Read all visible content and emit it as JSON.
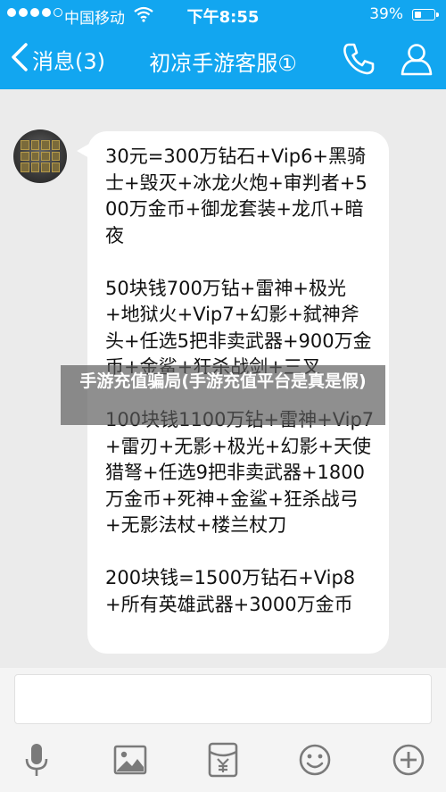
{
  "status_bar": {
    "carrier": "中国移动",
    "time": "下午8:55",
    "battery_pct": "39%",
    "battery_level": 0.39
  },
  "nav": {
    "back_label": "消息(3)",
    "title": "初凉手游客服①"
  },
  "message": {
    "text": "30元=300万钻石+Vip6+黑骑士+毁灭+冰龙火炮+审判者+500万金币+御龙套装+龙爪+暗夜\n\n50块钱700万钻+雷神+极光+地狱火+Vip7+幻影+弑神斧头+任选5把非卖武器+900万金币+金鲨+狂杀战剑+三叉\n\n100块钱1100万钻+雷神+Vip7+雷刃+无影+极光+幻影+天使猎弩+任选9把非卖武器+1800万金币+死神+金鲨+狂杀战弓+无影法杖+楼兰杖刀\n\n200块钱=1500万钻石+Vip8+所有英雄武器+3000万金币"
  },
  "overlay": {
    "text": "手游充值骗局(手游充值平台是真是假)"
  },
  "colors": {
    "header": "#12a6f0",
    "background": "#ebebeb",
    "bubble": "#ffffff",
    "icon_gray": "#7a7a7a"
  },
  "icons": {
    "back": "chevron-left-icon",
    "phone": "phone-icon",
    "profile": "person-icon",
    "voice": "microphone-icon",
    "image": "image-icon",
    "red_packet": "red-packet-icon",
    "emoji": "smiley-icon",
    "more": "plus-circle-icon"
  }
}
